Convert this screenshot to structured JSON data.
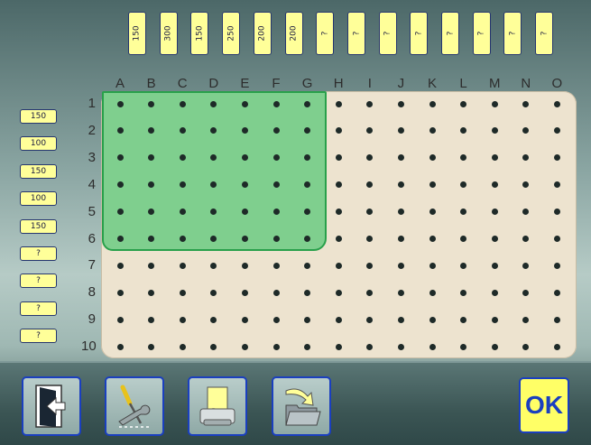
{
  "column_values": [
    "150",
    "300",
    "150",
    "250",
    "200",
    "200",
    "?",
    "?",
    "?",
    "?",
    "?",
    "?",
    "?",
    "?"
  ],
  "row_values": [
    "150",
    "100",
    "150",
    "100",
    "150",
    "?",
    "?",
    "?",
    "?"
  ],
  "column_letters": [
    "A",
    "B",
    "C",
    "D",
    "E",
    "F",
    "G",
    "H",
    "I",
    "J",
    "K",
    "L",
    "M",
    "N",
    "O"
  ],
  "row_numbers": [
    "1",
    "2",
    "3",
    "4",
    "5",
    "6",
    "7",
    "8",
    "9",
    "10"
  ],
  "selection": {
    "columns": [
      "A",
      "G"
    ],
    "rows": [
      "1",
      "6"
    ],
    "color": "#7fcf8e"
  },
  "board_color": "#ede3cf",
  "toolbar": {
    "exit_icon": "exit-door-icon",
    "tools_icon": "screwdriver-wrench-icon",
    "print_icon": "printer-icon",
    "open_icon": "open-folder-icon",
    "ok_label": "OK"
  }
}
